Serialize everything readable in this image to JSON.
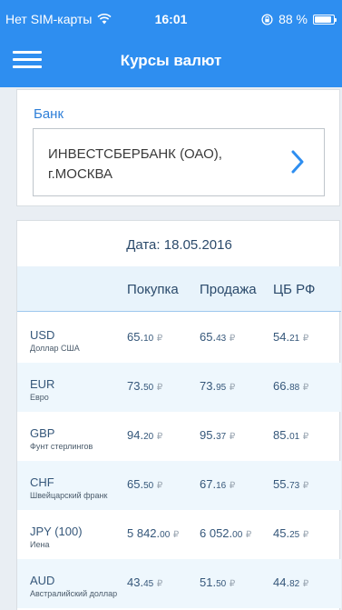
{
  "status_bar": {
    "carrier": "Нет SIM-карты",
    "time": "16:01",
    "battery": "88 %"
  },
  "header": {
    "title": "Курсы валют",
    "menu_icon": "hamburger-menu-icon"
  },
  "bank": {
    "label": "Банк",
    "name_line1": "ИНВЕСТСБЕРБАНК (ОАО),",
    "name_line2": "г.МОСКВА"
  },
  "rates": {
    "date": "Дата: 18.05.2016",
    "columns": {
      "buy": "Покупка",
      "sell": "Продажа",
      "cbr": "ЦБ РФ"
    },
    "currency_symbol": "₽",
    "rows": [
      {
        "code": "USD",
        "name": "Доллар США",
        "buy_int": "65.",
        "buy_dec": "10",
        "sell_int": "65.",
        "sell_dec": "43",
        "cbr_int": "54.",
        "cbr_dec": "21"
      },
      {
        "code": "EUR",
        "name": "Евро",
        "buy_int": "73.",
        "buy_dec": "50",
        "sell_int": "73.",
        "sell_dec": "95",
        "cbr_int": "66.",
        "cbr_dec": "88"
      },
      {
        "code": "GBP",
        "name": "Фунт стерлингов",
        "buy_int": "94.",
        "buy_dec": "20",
        "sell_int": "95.",
        "sell_dec": "37",
        "cbr_int": "85.",
        "cbr_dec": "01"
      },
      {
        "code": "CHF",
        "name": "Швейцарский франк",
        "buy_int": "65.",
        "buy_dec": "50",
        "sell_int": "67.",
        "sell_dec": "16",
        "cbr_int": "55.",
        "cbr_dec": "73"
      },
      {
        "code": "JPY (100)",
        "name": "Иена",
        "buy_int": "5 842.",
        "buy_dec": "00",
        "sell_int": "6 052.",
        "sell_dec": "00",
        "cbr_int": "45.",
        "cbr_dec": "25"
      },
      {
        "code": "AUD",
        "name": "Австралийский доллар",
        "buy_int": "43.",
        "buy_dec": "45",
        "sell_int": "51.",
        "sell_dec": "50",
        "cbr_int": "44.",
        "cbr_dec": "82"
      }
    ]
  },
  "colors": {
    "accent": "#2e8ef0",
    "link": "#2e7fd8",
    "row_alt": "#eef7fd"
  }
}
